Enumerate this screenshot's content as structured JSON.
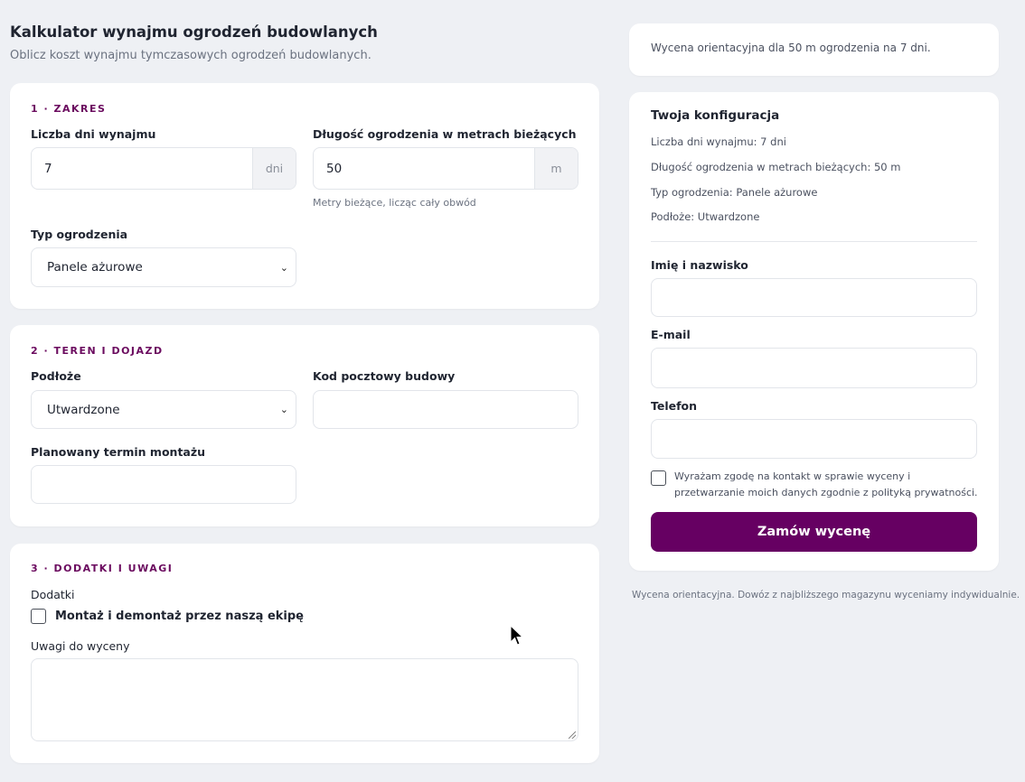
{
  "page": {
    "title": "Kalkulator wynajmu ogrodzeń budowlanych",
    "subtitle": "Oblicz koszt wynajmu tymczasowych ogrodzeń budowlanych."
  },
  "section1": {
    "title": "1 · ZAKRES",
    "days_label": "Liczba dni wynajmu",
    "days_value": "7",
    "days_unit": "dni",
    "length_label": "Długość ogrodzenia w metrach bieżących",
    "length_value": "50",
    "length_unit": "m",
    "length_hint": "Metry bieżące, licząc cały obwód",
    "type_label": "Typ ogrodzenia",
    "type_value": "Panele ażurowe"
  },
  "section2": {
    "title": "2 · TEREN I DOJAZD",
    "ground_label": "Podłoże",
    "ground_value": "Utwardzone",
    "postal_label": "Kod pocztowy budowy",
    "postal_value": "",
    "date_label": "Planowany termin montażu",
    "date_value": ""
  },
  "section3": {
    "title": "3 · DODATKI I UWAGI",
    "addons_label": "Dodatki",
    "addon_install_label": "Montaż i demontaż przez naszą ekipę",
    "addon_install_checked": false,
    "notes_label": "Uwagi do wyceny",
    "notes_value": ""
  },
  "summary": {
    "text": "Wycena orientacyjna dla 50 m ogrodzenia na 7 dni."
  },
  "config": {
    "title": "Twoja konfiguracja",
    "lines": [
      "Liczba dni wynajmu: 7 dni",
      "Długość ogrodzenia w metrach bieżących: 50 m",
      "Typ ogrodzenia: Panele ażurowe",
      "Podłoże: Utwardzone"
    ],
    "name_label": "Imię i nazwisko",
    "email_label": "E-mail",
    "phone_label": "Telefon",
    "consent_text": "Wyrażam zgodę na kontakt w sprawie wyceny i przetwarzanie moich danych zgodnie z polityką prywatności.",
    "consent_checked": false,
    "button_label": "Zamów wycenę"
  },
  "footnote": "Wycena orientacyjna. Dowóz z najbliższego magazynu wyceniamy indywidualnie.",
  "colors": {
    "accent": "#660062",
    "section_title": "#6b0b5f",
    "background": "#eef0f4"
  }
}
